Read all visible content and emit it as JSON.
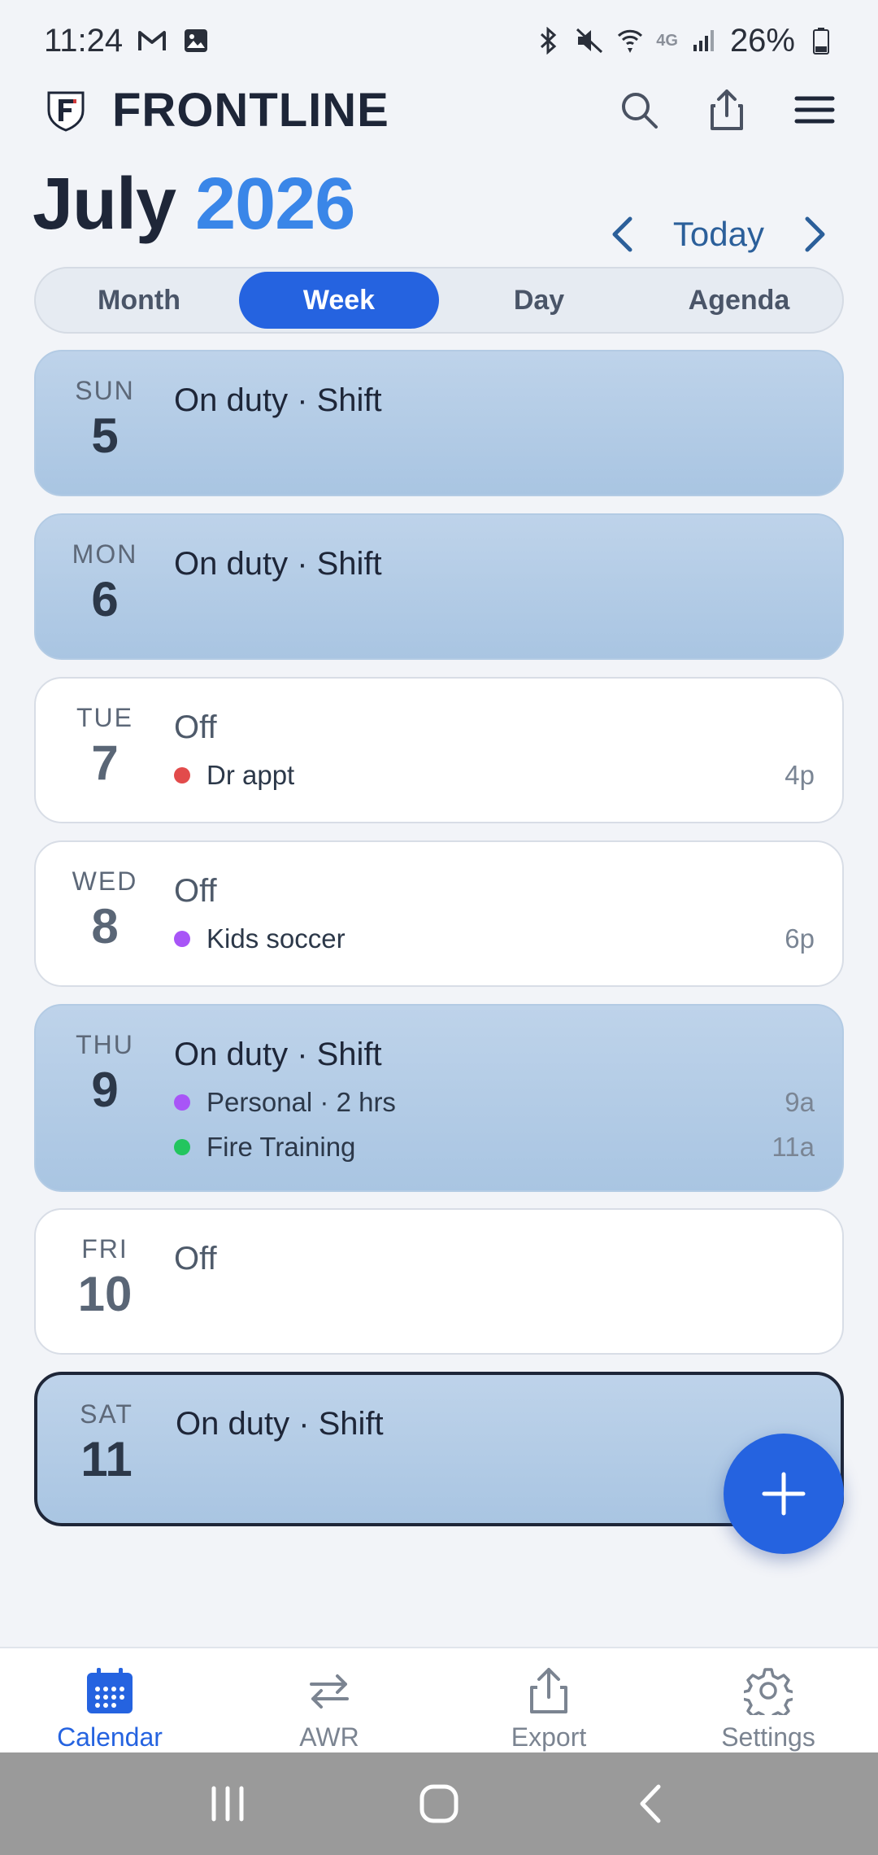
{
  "status_bar": {
    "time": "11:24",
    "network_label": "4G",
    "battery": "26%",
    "left_icons": [
      "gmail-icon",
      "gallery-icon"
    ],
    "right_icons": [
      "bluetooth-icon",
      "mute-icon",
      "wifi-icon",
      "signal-icon",
      "battery-icon"
    ]
  },
  "header": {
    "brand": "FRONTLINE",
    "logo_letter": "F",
    "actions": [
      "search-icon",
      "share-icon",
      "menu-icon"
    ]
  },
  "calendar": {
    "month": "July",
    "year": "2026",
    "today_label": "Today",
    "views": [
      "Month",
      "Week",
      "Day",
      "Agenda"
    ],
    "active_view": "Week"
  },
  "days": [
    {
      "dow": "SUN",
      "day": "5",
      "status": "On duty · Shift",
      "type": "duty",
      "events": []
    },
    {
      "dow": "MON",
      "day": "6",
      "status": "On duty · Shift",
      "type": "duty",
      "events": []
    },
    {
      "dow": "TUE",
      "day": "7",
      "status": "Off",
      "type": "off",
      "events": [
        {
          "label": "Dr appt",
          "time": "4p",
          "color": "#e24b4b"
        }
      ]
    },
    {
      "dow": "WED",
      "day": "8",
      "status": "Off",
      "type": "off",
      "events": [
        {
          "label": "Kids soccer",
          "time": "6p",
          "color": "#a855f7"
        }
      ]
    },
    {
      "dow": "THU",
      "day": "9",
      "status": "On duty · Shift",
      "type": "duty",
      "events": [
        {
          "label": "Personal · 2 hrs",
          "time": "9a",
          "color": "#a855f7"
        },
        {
          "label": "Fire Training",
          "time": "11a",
          "color": "#22c55e"
        }
      ]
    },
    {
      "dow": "FRI",
      "day": "10",
      "status": "Off",
      "type": "off",
      "events": []
    },
    {
      "dow": "SAT",
      "day": "11",
      "status": "On duty · Shift",
      "type": "duty",
      "selected": true,
      "events": []
    }
  ],
  "fab": {
    "icon": "plus-icon"
  },
  "bottom_nav": [
    {
      "label": "Calendar",
      "icon": "calendar-icon",
      "active": true
    },
    {
      "label": "AWR",
      "icon": "swap-icon",
      "active": false
    },
    {
      "label": "Export",
      "icon": "export-icon",
      "active": false
    },
    {
      "label": "Settings",
      "icon": "settings-icon",
      "active": false
    }
  ],
  "colors": {
    "accent": "#2563e0",
    "year": "#3a86e8",
    "duty_card": "#b4cce6",
    "off_card": "#ffffff"
  }
}
